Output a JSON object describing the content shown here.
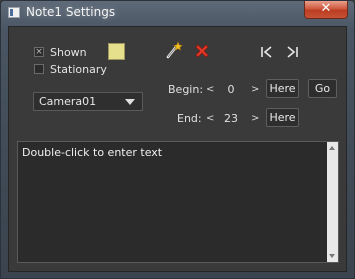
{
  "window": {
    "title": "Note1 Settings",
    "close_symbol": "✕"
  },
  "options": {
    "shown": {
      "label": "Shown",
      "checked": true
    },
    "stationary": {
      "label": "Stationary",
      "checked": false
    },
    "note_color": "#e6df8c"
  },
  "camera_select": {
    "value": "Camera01"
  },
  "toolbar": {
    "icons": [
      "magic-wand-icon",
      "delete-x-icon",
      "go-to-start-icon",
      "go-to-end-icon"
    ]
  },
  "range": {
    "begin": {
      "label": "Begin:",
      "value": "0",
      "here_label": "Here"
    },
    "end": {
      "label": "End:",
      "value": "23",
      "here_label": "Here"
    },
    "go_label": "Go",
    "dec_symbol": "<",
    "inc_symbol": ">"
  },
  "note_text": {
    "placeholder": "Double-click to enter text"
  },
  "colors": {
    "accent_close": "#c75236"
  }
}
